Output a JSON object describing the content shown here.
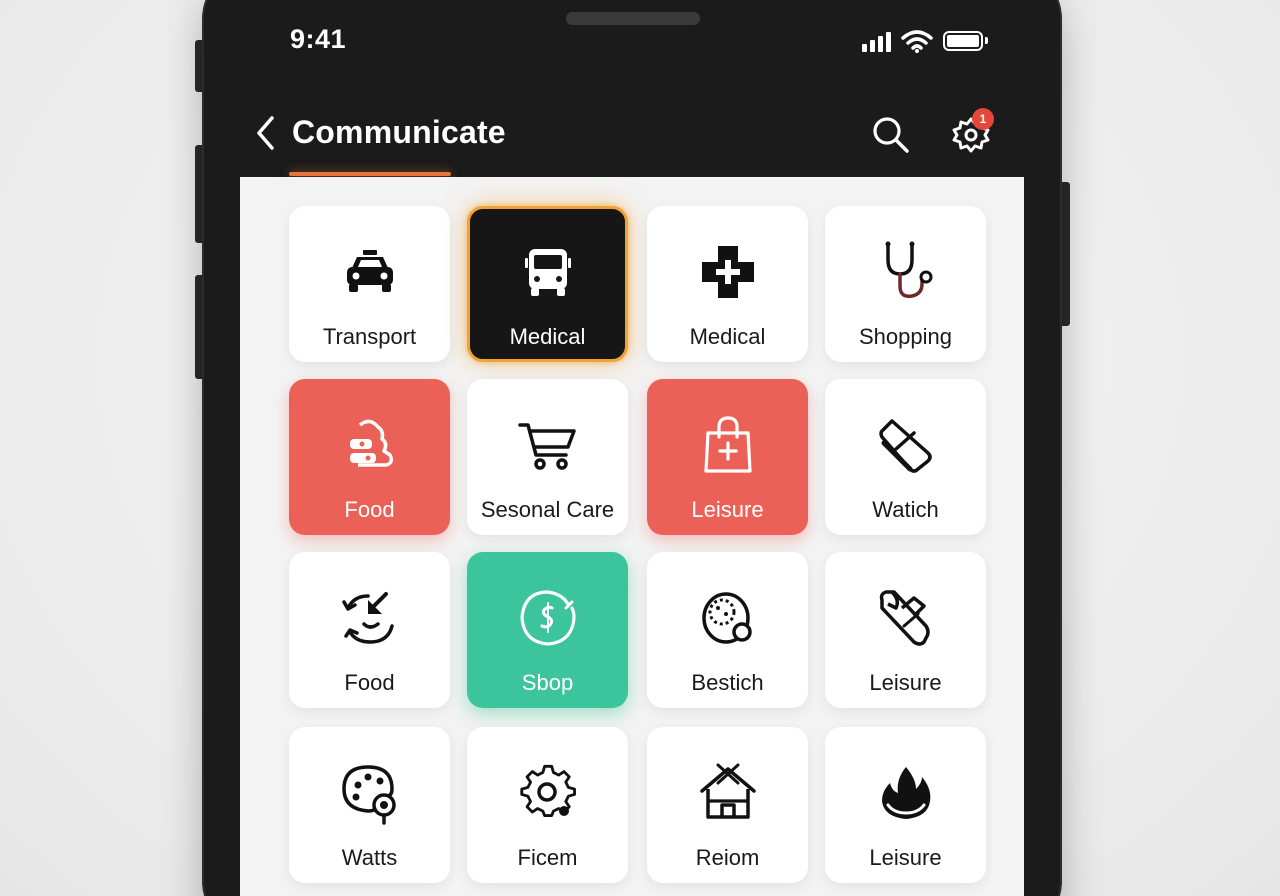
{
  "status_bar": {
    "time": "9:41"
  },
  "header": {
    "title": "Communicate",
    "badge_count": "1"
  },
  "colors": {
    "accent_underline": "#e8743b",
    "highlight_border": "#f0a235",
    "red_tile": "#ec6157",
    "green_tile": "#3cc59c",
    "badge": "#e4483a"
  },
  "tiles": [
    {
      "label": "Transport",
      "icon": "taxi-icon",
      "style": "white"
    },
    {
      "label": "Medical",
      "icon": "bus-icon",
      "style": "dark-selected"
    },
    {
      "label": "Medical",
      "icon": "medical-cross-icon",
      "style": "white"
    },
    {
      "label": "Shopping",
      "icon": "stethoscope-icon",
      "style": "white"
    },
    {
      "label": "Food",
      "icon": "food-icon",
      "style": "red"
    },
    {
      "label": "Sesonal Care",
      "icon": "shopping-cart-icon",
      "style": "white"
    },
    {
      "label": "Leisure",
      "icon": "shopping-bag-icon",
      "style": "red"
    },
    {
      "label": "Watich",
      "icon": "tag-icon",
      "style": "white"
    },
    {
      "label": "Food",
      "icon": "refresh-arrow-icon",
      "style": "white"
    },
    {
      "label": "Sbop",
      "icon": "dollar-circle-icon",
      "style": "green"
    },
    {
      "label": "Bestich",
      "icon": "cookie-icon",
      "style": "white"
    },
    {
      "label": "Leisure",
      "icon": "bandage-icon",
      "style": "white"
    },
    {
      "label": "Watts",
      "icon": "palette-icon",
      "style": "white"
    },
    {
      "label": "Ficem",
      "icon": "gear-icon",
      "style": "white"
    },
    {
      "label": "Reiom",
      "icon": "house-icon",
      "style": "white"
    },
    {
      "label": "Leisure",
      "icon": "flame-icon",
      "style": "white"
    }
  ]
}
